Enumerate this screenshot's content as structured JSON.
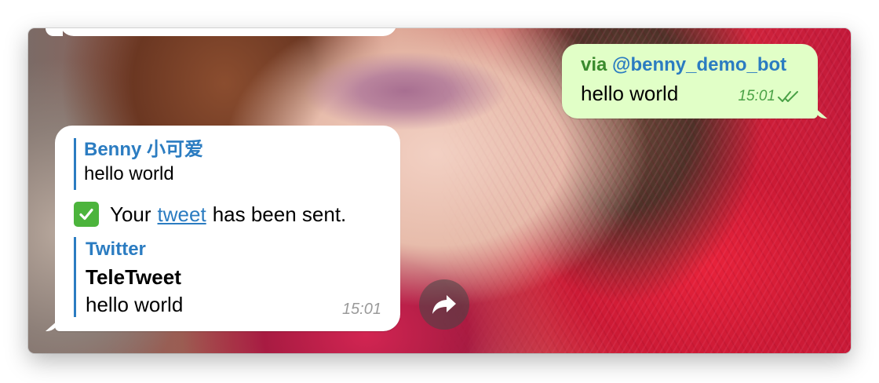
{
  "outgoing": {
    "via_label": "via",
    "bot_username": "@benny_demo_bot",
    "text": "hello world",
    "time": "15:01",
    "status": "read",
    "colors": {
      "bubble": "#e1ffc7",
      "via": "#3b8b2e",
      "bot": "#2b7cc1",
      "meta": "#4aa146"
    }
  },
  "incoming": {
    "reply": {
      "author": "Benny 小可爱",
      "text": "hello world"
    },
    "emoji": "white-heavy-check-mark",
    "text_before_link": "Your",
    "link_text": "tweet",
    "text_after_link": "has been sent.",
    "preview": {
      "site_name": "Twitter",
      "title": "TeleTweet",
      "description": "hello world"
    },
    "time": "15:01",
    "colors": {
      "accent": "#2b7cc1",
      "time": "#9a9a9a"
    }
  },
  "share_button": {
    "icon": "share-arrow-icon"
  }
}
